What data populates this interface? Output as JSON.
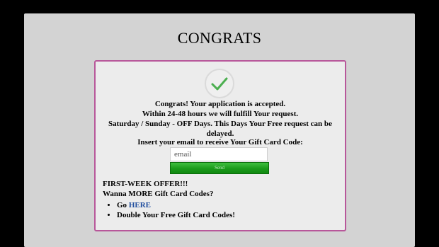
{
  "page": {
    "title": "CONGRATS"
  },
  "card": {
    "message_lines": [
      "Congrats! Your application is accepted.",
      "Within 24-48 hours we will fulfill Your request.",
      "Saturday / Sunday - OFF Days. This Days Your Free request can be delayed."
    ],
    "insert_label": "Insert your email to receive Your Gift Card Code:",
    "email_placeholder": "email",
    "send_label": "Send",
    "offer_heading": "FIRST-WEEK OFFER!!!",
    "offer_line_prefix": "Wanna ",
    "offer_line_strong": "MORE Gift Card Codes?",
    "bullet_1_prefix": "Go ",
    "bullet_1_link": "HERE",
    "bullet_2": "Double Your Free Gift Card Codes!"
  },
  "icons": {
    "success": "checkmark-icon"
  },
  "colors": {
    "card_border": "#b8579a",
    "check_green": "#4caf50",
    "send_button": "#1a9a1a",
    "link": "#1f4d9e"
  }
}
